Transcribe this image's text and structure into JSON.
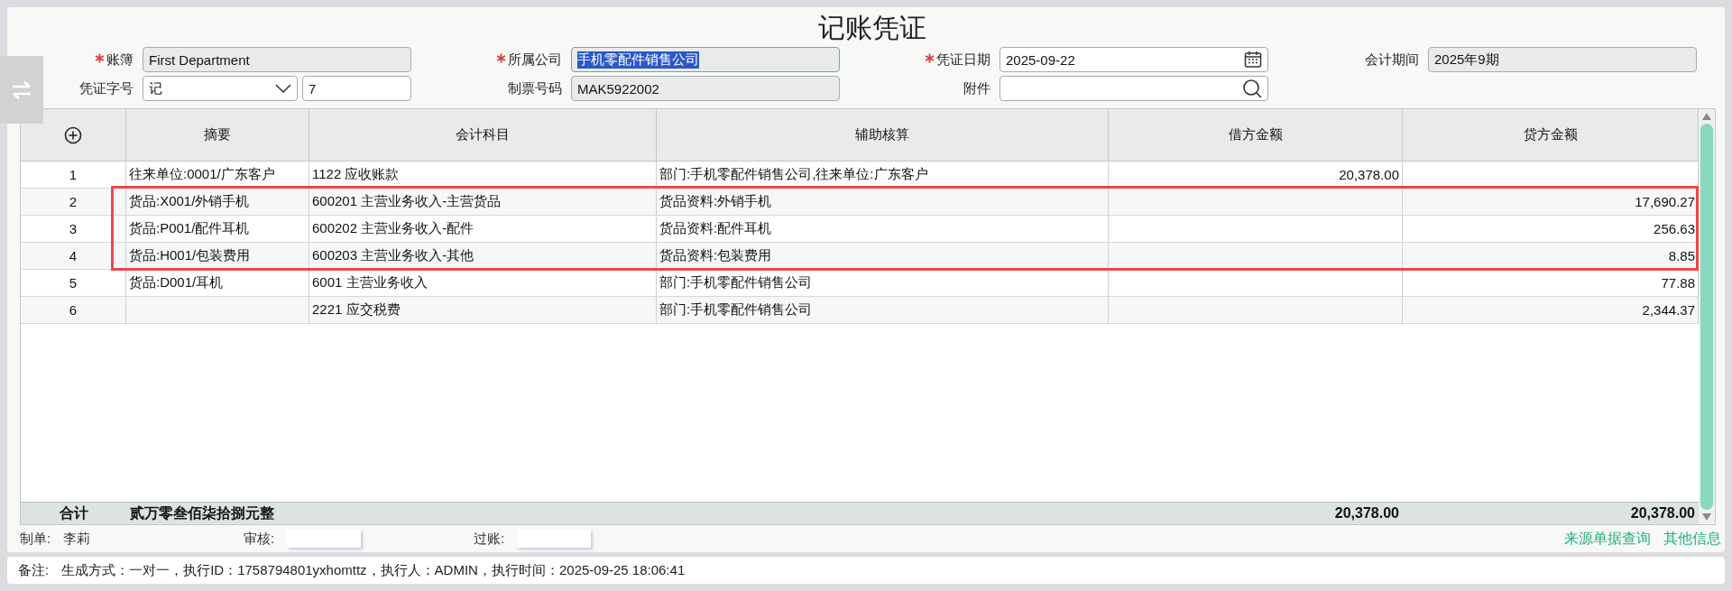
{
  "title": "记账凭证",
  "fields": [
    {
      "label": "账簿",
      "required": true,
      "value": "First Department",
      "readonly": true,
      "kind": "text"
    },
    {
      "label": "所属公司",
      "required": true,
      "value": "手机零配件销售公司",
      "readonly": true,
      "focused": true,
      "kind": "text"
    },
    {
      "label": "凭证日期",
      "required": true,
      "value": "2025-09-22",
      "readonly": false,
      "kind": "date"
    },
    {
      "label": "会计期间",
      "required": false,
      "value": "2025年9期",
      "readonly": true,
      "kind": "text"
    },
    {
      "label": "凭证字号",
      "required": false,
      "value": "记",
      "number": "7",
      "readonly": false,
      "kind": "select"
    },
    {
      "label": "制票号码",
      "required": false,
      "value": "MAK5922002",
      "readonly": true,
      "kind": "text"
    },
    {
      "label": "附件",
      "required": false,
      "readonly": false,
      "kind": "search"
    }
  ],
  "table": {
    "columns": [
      "摘要",
      "会计科目",
      "辅助核算",
      "借方金额",
      "贷方金额"
    ],
    "rows": [
      {
        "index": "1",
        "summary": "往来单位:0001/广东客户",
        "account": "1122 应收账款",
        "auxiliary": "部门:手机零配件销售公司,往来单位:广东客户",
        "debit": "20,378.00",
        "credit": "",
        "highlighted": false
      },
      {
        "index": "2",
        "summary": "货品:X001/外销手机",
        "account": "600201 主营业务收入-主营货品",
        "auxiliary": "货品资料:外销手机",
        "debit": "",
        "credit": "17,690.27",
        "highlighted": true
      },
      {
        "index": "3",
        "summary": "货品:P001/配件耳机",
        "account": "600202 主营业务收入-配件",
        "auxiliary": "货品资料:配件耳机",
        "debit": "",
        "credit": "256.63",
        "highlighted": true
      },
      {
        "index": "4",
        "summary": "货品:H001/包装费用",
        "account": "600203 主营业务收入-其他",
        "auxiliary": "货品资料:包装费用",
        "debit": "",
        "credit": "8.85",
        "highlighted": true
      },
      {
        "index": "5",
        "summary": "货品:D001/耳机",
        "account": "6001 主营业务收入",
        "auxiliary": "部门:手机零配件销售公司",
        "debit": "",
        "credit": "77.88",
        "highlighted": false
      },
      {
        "index": "6",
        "summary": "",
        "account": "2221 应交税费",
        "auxiliary": "部门:手机零配件销售公司",
        "debit": "",
        "credit": "2,344.37",
        "highlighted": false
      }
    ],
    "total": {
      "label": "合计",
      "words": "贰万零叁佰柒拾捌元整",
      "debit": "20,378.00",
      "credit": "20,378.00"
    }
  },
  "signatures": [
    {
      "label": "制单:",
      "value": "李莉"
    },
    {
      "label": "审核:"
    },
    {
      "label": "过账:"
    }
  ],
  "links": [
    "来源单据查询",
    "其他信息"
  ],
  "remark": {
    "label": "备注:",
    "text": "生成方式：一对一，执行ID：1758794801yxhomttz，执行人：ADMIN，执行时间：2025-09-25 18:06:41"
  }
}
